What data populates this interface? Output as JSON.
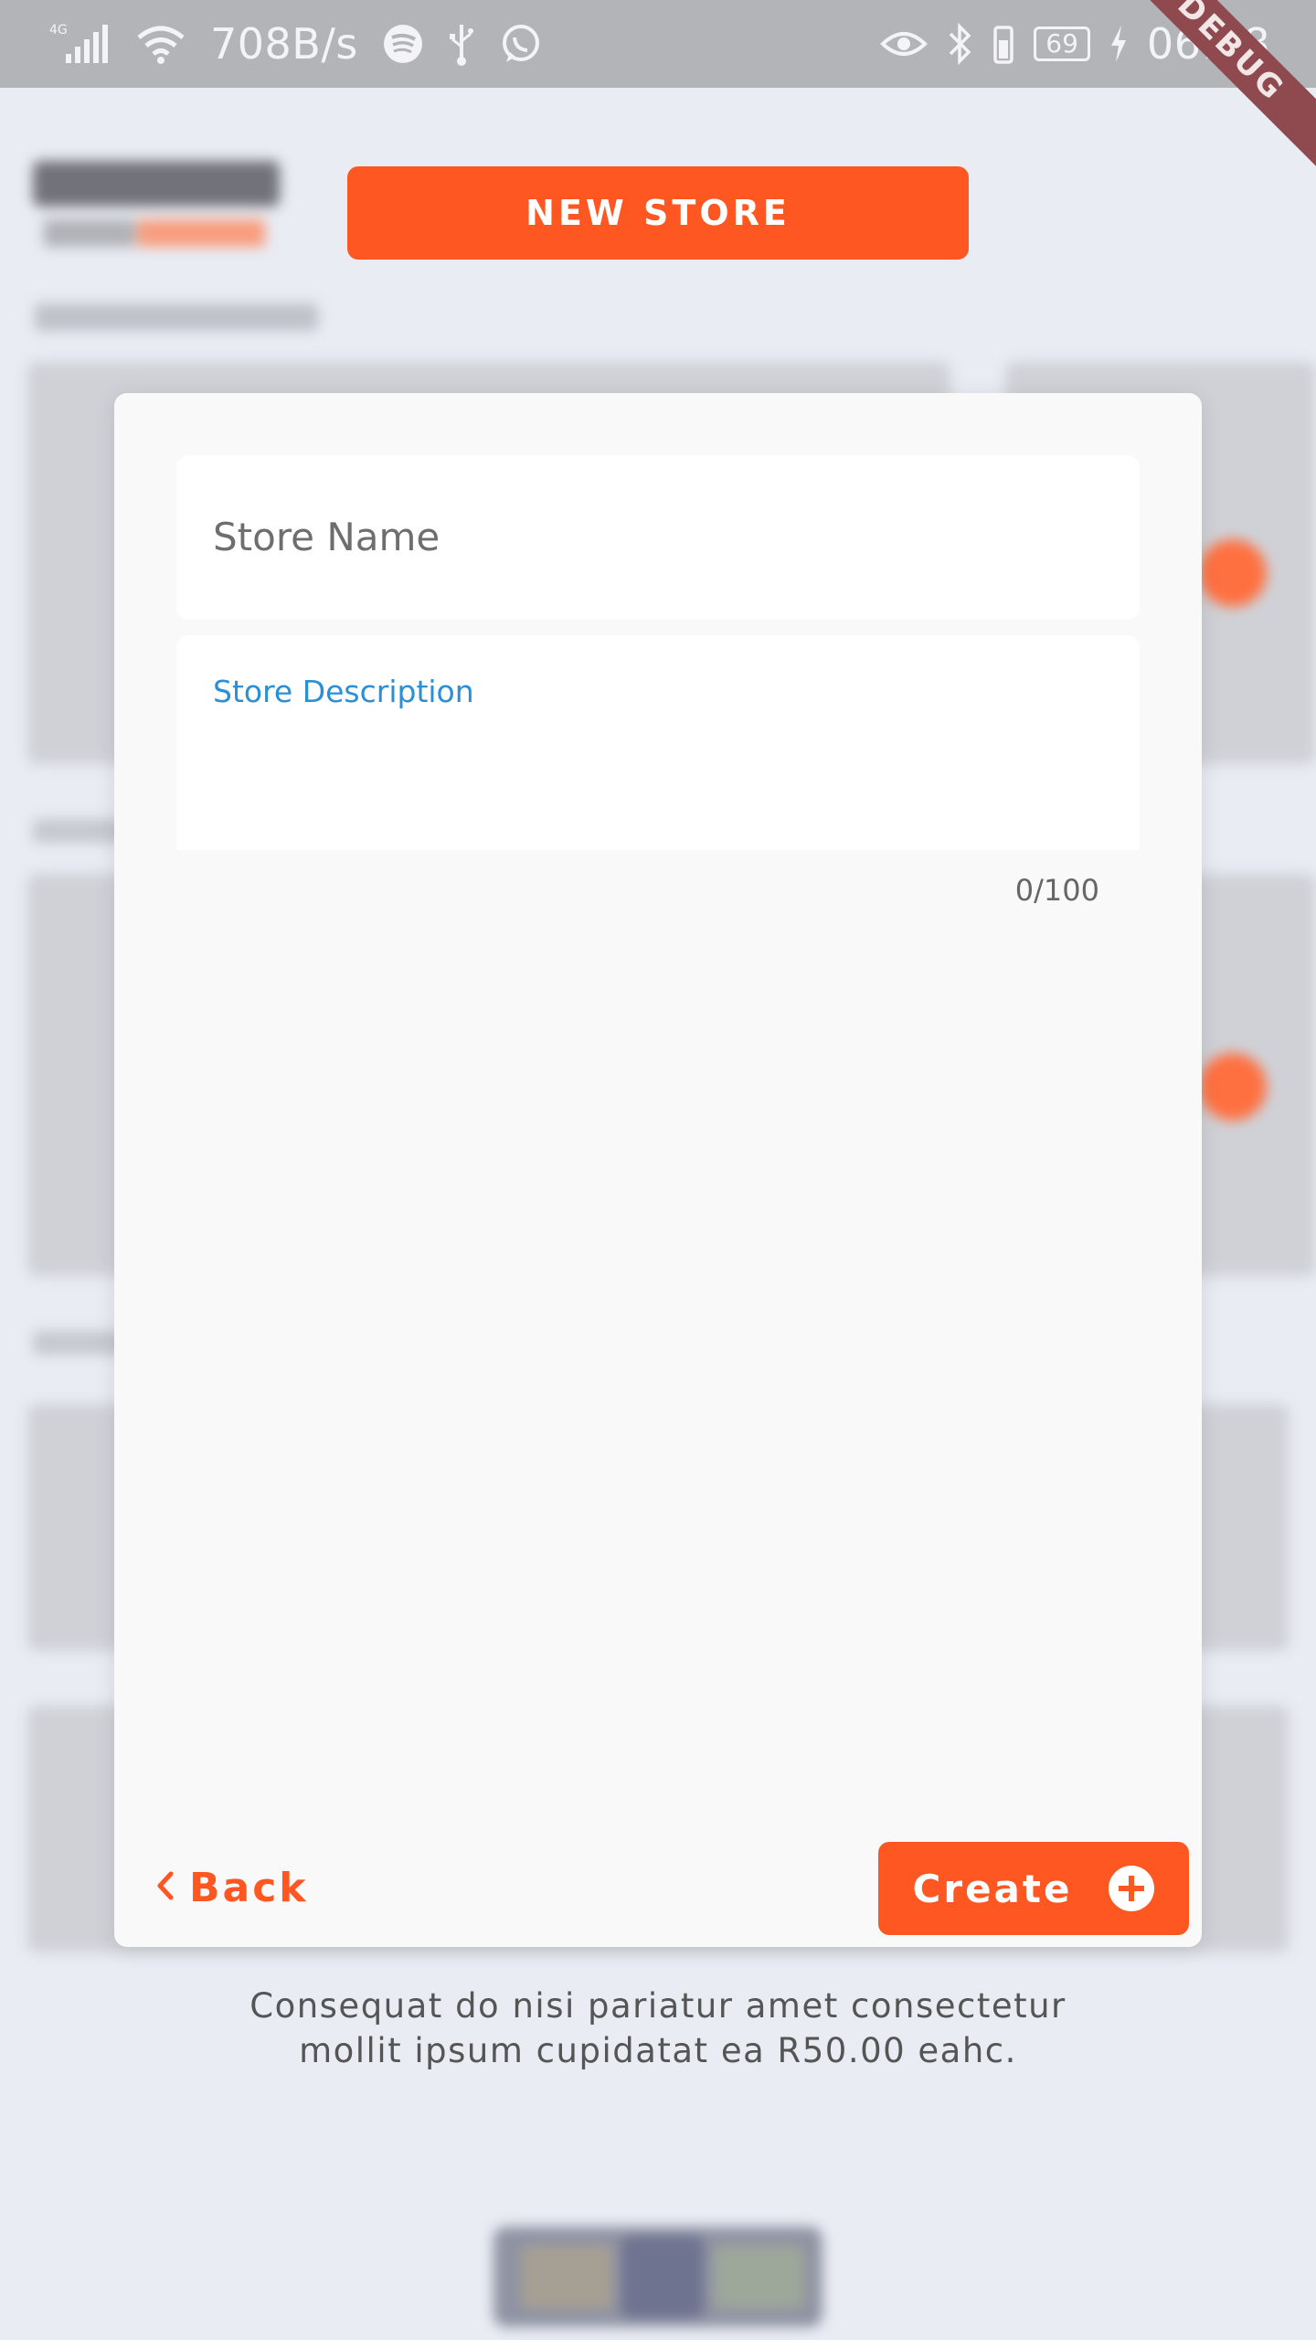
{
  "status_bar": {
    "network_type": "4G",
    "speed": "708B/s",
    "battery_level": "69",
    "time": "06:58",
    "debug_label": "DEBUG",
    "left_icons": [
      "signal-icon",
      "wifi-icon",
      "spotify-icon",
      "usb-icon",
      "whatsapp-icon"
    ],
    "right_icons": [
      "eye-icon",
      "bluetooth-icon",
      "vibrate-icon",
      "battery-icon",
      "charging-icon"
    ]
  },
  "header": {
    "new_store_label": "NEW STORE"
  },
  "dialog": {
    "store_name_placeholder": "Store Name",
    "store_description_label": "Store Description",
    "char_counter": "0/100",
    "back_label": "Back",
    "create_label": "Create"
  },
  "footer": {
    "line1": "Consequat do nisi pariatur amet consectetur",
    "line2": "mollit ipsum cupidatat ea R50.00 eahc."
  },
  "colors": {
    "accent": "#ff5722",
    "link_blue": "#2b8fd6",
    "status_bar": "#b3b4b8",
    "background": "#e9ecf3",
    "dialog_bg": "#f9f9f9"
  }
}
